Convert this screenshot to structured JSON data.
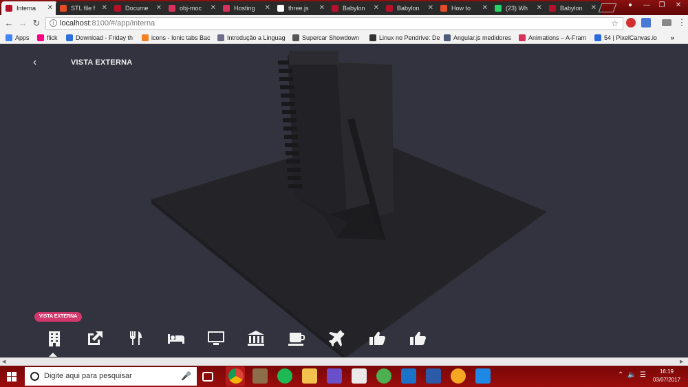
{
  "browser": {
    "tabs": [
      {
        "label": "Interna",
        "favicon_color": "#b3122a",
        "active": true
      },
      {
        "label": "STL file f",
        "favicon_color": "#e44d26"
      },
      {
        "label": "Docume",
        "favicon_color": "#b3122a"
      },
      {
        "label": "obj-moc",
        "favicon_color": "#d6325c"
      },
      {
        "label": "Hosting",
        "favicon_color": "#d6325c"
      },
      {
        "label": "three.js",
        "favicon_color": "#ffffff"
      },
      {
        "label": "Babylon",
        "favicon_color": "#b3122a"
      },
      {
        "label": "Babylon",
        "favicon_color": "#b3122a"
      },
      {
        "label": "How to",
        "favicon_color": "#e44d26"
      },
      {
        "label": "(23) Wh",
        "favicon_color": "#25d366"
      },
      {
        "label": "Babylon",
        "favicon_color": "#b3122a"
      }
    ],
    "url_host": "localhost",
    "url_path": ":8100/#/app/interna",
    "bookmarks": [
      {
        "label": "Apps",
        "icon_color": "#4285f4"
      },
      {
        "label": "flick",
        "icon_color": "#ff0084"
      },
      {
        "label": "Download - Friday th",
        "icon_color": "#2f6fd8"
      },
      {
        "label": "icons - Ionic tabs Bac",
        "icon_color": "#f48024"
      },
      {
        "label": "Introdução a Linguag",
        "icon_color": "#6d6d8a"
      },
      {
        "label": "Supercar Showdown",
        "icon_color": "#555555"
      },
      {
        "label": "Linux no Pendrive: De",
        "icon_color": "#333333"
      },
      {
        "label": "Angular.js medidores",
        "icon_color": "#4b5b78"
      },
      {
        "label": "Animations – A-Fram",
        "icon_color": "#d6325c"
      },
      {
        "label": "54 | PixelCanvas.io",
        "icon_color": "#2b6be0"
      }
    ],
    "more_bookmarks": "»"
  },
  "app": {
    "back_icon": "‹",
    "title": "VISTA EXTERNA",
    "badge": "VISTA EXTERNA",
    "icons": [
      {
        "name": "building-icon"
      },
      {
        "name": "external-link-icon"
      },
      {
        "name": "restaurant-icon"
      },
      {
        "name": "bed-icon"
      },
      {
        "name": "monitor-icon"
      },
      {
        "name": "bank-icon"
      },
      {
        "name": "coffee-icon"
      },
      {
        "name": "airplane-icon"
      },
      {
        "name": "thumbs-up-icon"
      },
      {
        "name": "thumbs-up-icon"
      }
    ]
  },
  "taskbar": {
    "search_placeholder": "Digite aqui para pesquisar",
    "time": "16:19",
    "date": "03/07/2017"
  }
}
